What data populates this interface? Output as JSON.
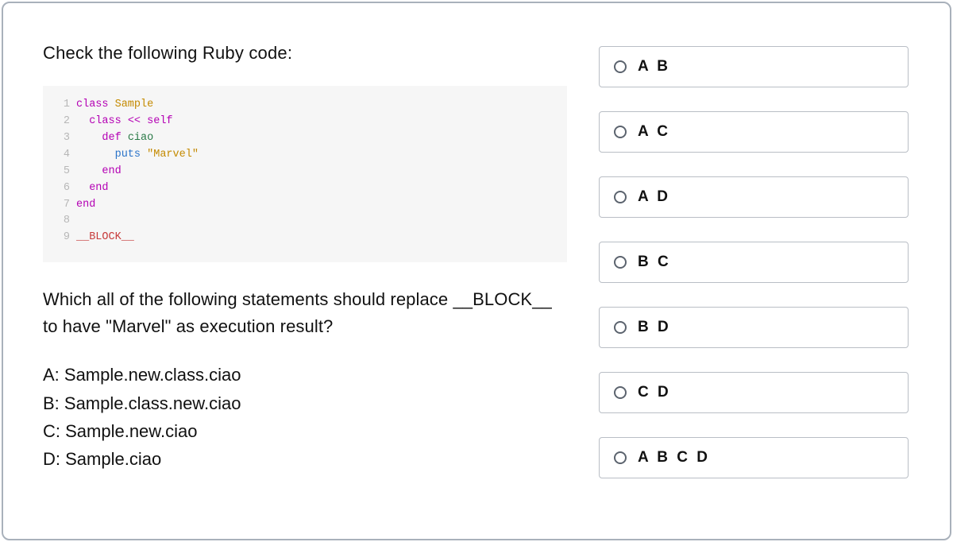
{
  "intro": "Check the  following Ruby code:",
  "code": {
    "lines": [
      {
        "n": "1",
        "tokens": [
          {
            "t": "class ",
            "c": "kw"
          },
          {
            "t": "Sample",
            "c": "cls"
          }
        ]
      },
      {
        "n": "2",
        "tokens": [
          {
            "t": "  ",
            "c": ""
          },
          {
            "t": "class ",
            "c": "kw"
          },
          {
            "t": "<< ",
            "c": "kw"
          },
          {
            "t": "self",
            "c": "kw"
          }
        ]
      },
      {
        "n": "3",
        "tokens": [
          {
            "t": "    ",
            "c": ""
          },
          {
            "t": "def ",
            "c": "kw"
          },
          {
            "t": "ciao",
            "c": "meth"
          }
        ]
      },
      {
        "n": "4",
        "tokens": [
          {
            "t": "      ",
            "c": ""
          },
          {
            "t": "puts ",
            "c": "fn"
          },
          {
            "t": "\"Marvel\"",
            "c": "str"
          }
        ]
      },
      {
        "n": "5",
        "tokens": [
          {
            "t": "    ",
            "c": ""
          },
          {
            "t": "end",
            "c": "kw"
          }
        ]
      },
      {
        "n": "6",
        "tokens": [
          {
            "t": "  ",
            "c": ""
          },
          {
            "t": "end",
            "c": "kw"
          }
        ]
      },
      {
        "n": "7",
        "tokens": [
          {
            "t": "end",
            "c": "kw"
          }
        ]
      },
      {
        "n": "8",
        "tokens": [
          {
            "t": "",
            "c": ""
          }
        ]
      },
      {
        "n": "9",
        "tokens": [
          {
            "t": "__BLOCK__",
            "c": "blk"
          }
        ]
      }
    ]
  },
  "question": "Which all of the following statements should replace __BLOCK__ to have \"Marvel\" as execution result?",
  "statements": [
    "A: Sample.new.class.ciao",
    "B: Sample.class.new.ciao",
    "C: Sample.new.ciao",
    "D: Sample.ciao"
  ],
  "options": [
    {
      "label": "A B"
    },
    {
      "label": "A C"
    },
    {
      "label": "A D"
    },
    {
      "label": "B C"
    },
    {
      "label": "B D"
    },
    {
      "label": "C D"
    },
    {
      "label": "A B C D"
    }
  ]
}
